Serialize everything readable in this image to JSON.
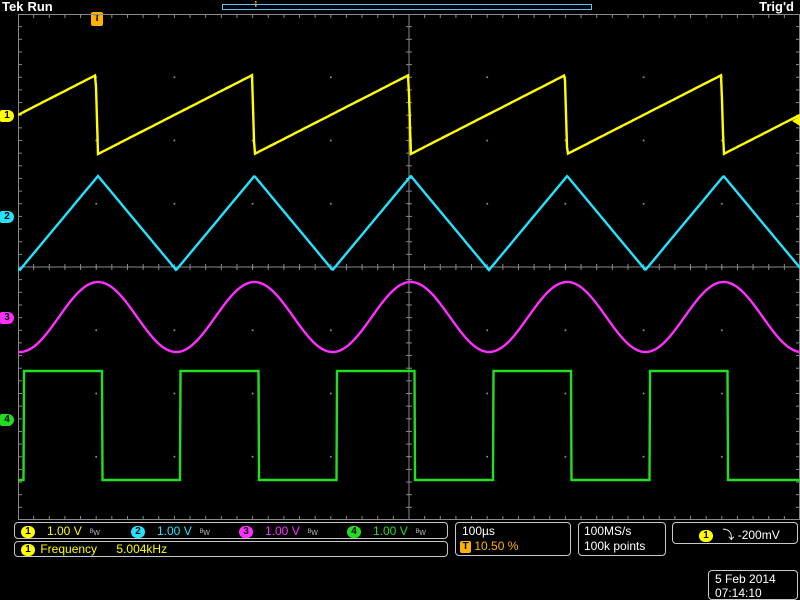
{
  "header": {
    "brand": "Tek",
    "state": "Run",
    "trigger_status": "Trig'd",
    "trigger_position_marker": "T"
  },
  "channels": [
    {
      "id": "1",
      "label": "1",
      "scale": "1.00 V",
      "color": "#ffff00"
    },
    {
      "id": "2",
      "label": "2",
      "scale": "1.00 V",
      "color": "#25e2ff"
    },
    {
      "id": "3",
      "label": "3",
      "scale": "1.00 V",
      "color": "#ff30ff"
    },
    {
      "id": "4",
      "label": "4",
      "scale": "1.00 V",
      "color": "#22dd22"
    }
  ],
  "measurement": {
    "channel": "1",
    "name": "Frequency",
    "value": "5.004kHz"
  },
  "timebase": {
    "scale": "100µs",
    "trigger_marker": "T",
    "trigger_position": "10.50 %"
  },
  "sampling": {
    "rate": "100MS/s",
    "record_length": "100k points"
  },
  "trigger": {
    "channel": "1",
    "slope_symbol": "⤵",
    "level": "-200mV"
  },
  "datetime": {
    "date": "5 Feb  2014",
    "time": "07:14:10"
  },
  "colors": {
    "grid": "#8a8a8a",
    "accent": "#ffb300",
    "ch1": "#ffff00",
    "ch2": "#25e2ff",
    "ch3": "#ff30ff",
    "ch4": "#22dd22"
  }
}
